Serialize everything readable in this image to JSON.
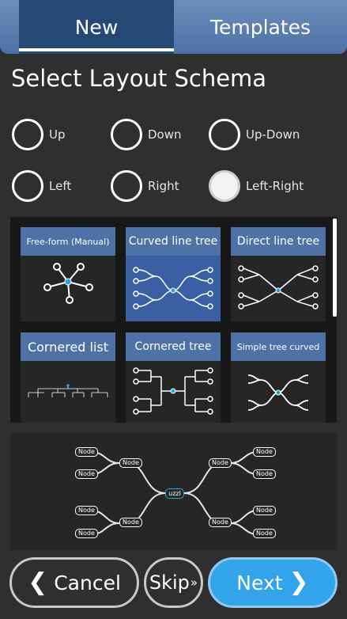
{
  "tabs": {
    "new_label": "New",
    "templates_label": "Templates"
  },
  "heading": "Select Layout Schema",
  "radios": {
    "up": "Up",
    "down": "Down",
    "up_down": "Up-Down",
    "left": "Left",
    "right": "Right",
    "left_right": "Left-Right",
    "selected": "Left-Right"
  },
  "layouts": {
    "free_form": "Free-form (Manual)",
    "curved_tree": "Curved line tree",
    "direct_tree": "Direct line tree",
    "cornered_list": "Cornered list",
    "cornered_tree": "Cornered tree",
    "simple_curved": "Simple tree curved",
    "selected": "Curved line tree"
  },
  "preview": {
    "node_label": "Node",
    "center_label": "uzzl"
  },
  "buttons": {
    "cancel": "Cancel",
    "skip": "Skip",
    "next": "Next"
  },
  "colors": {
    "accent": "#33a3ec",
    "tab_bg": "#4e72a6",
    "tab_active": "#254875",
    "panel": "#181818"
  }
}
